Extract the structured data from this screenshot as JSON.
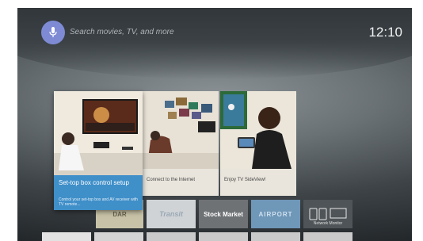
{
  "search": {
    "placeholder": "Search movies, TV, and more"
  },
  "clock": "12:10",
  "cards": {
    "featured": {
      "title": "Set-top box control setup",
      "description": "Control your set-top box and AV receiver with TV remote..."
    },
    "connect": {
      "caption": "Connect to the Internet"
    },
    "sideview": {
      "caption": "Enjoy TV SideView!"
    }
  },
  "apps": [
    {
      "label": "DAR"
    },
    {
      "label": "Transit"
    },
    {
      "label": "Stock Market"
    },
    {
      "label": "AIRPORT"
    },
    {
      "label": "Network Monitor"
    }
  ]
}
